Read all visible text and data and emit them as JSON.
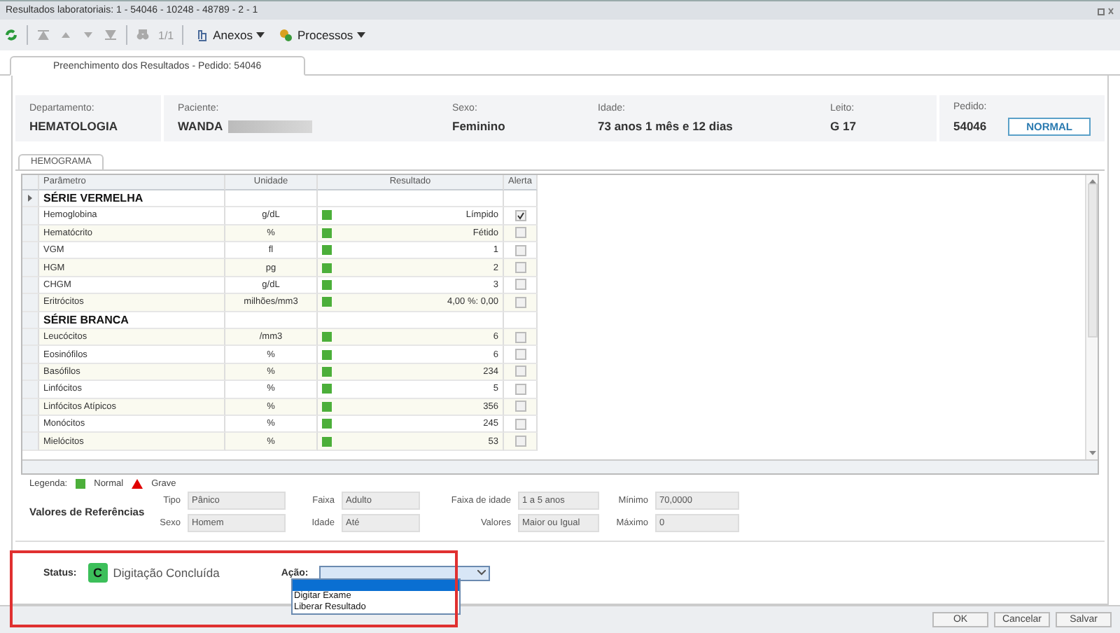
{
  "window": {
    "title": "Resultados laboratoriais: 1 - 54046 - 10248 - 48789 - 2 - 1"
  },
  "toolbar": {
    "pager": "1/1",
    "menus": [
      {
        "label": "Anexos",
        "kind": "attach"
      },
      {
        "label": "Processos",
        "kind": "process"
      }
    ]
  },
  "tabs": [
    {
      "label": "Preenchimento dos Resultados - Pedido: 54046",
      "selected": true
    }
  ],
  "header_fields": [
    {
      "label": "Departamento:",
      "value": "HEMATOLOGIA"
    },
    {
      "label": "Paciente:",
      "value": "WANDA",
      "redacted": true
    },
    {
      "label": "Sexo:",
      "value": "Feminino"
    },
    {
      "label": "Idade:",
      "value": "73 anos 1 mês  e 12 dias"
    },
    {
      "label": "Leito:",
      "value": "G 17"
    }
  ],
  "pedido": {
    "label": "Pedido:",
    "value": "54046",
    "priority": "NORMAL"
  },
  "subtabs": [
    {
      "label": "HEMOGRAMA",
      "selected": true
    }
  ],
  "table": {
    "columns": [
      "Parâmetro",
      "Unidade",
      "Resultado",
      "Alerta"
    ],
    "rows": [
      {
        "kind": "group",
        "name": "SÉRIE VERMELHA",
        "current": true
      },
      {
        "kind": "param",
        "name": "Hemoglobina",
        "unit": "g/dL",
        "result": "Límpido",
        "color": "#4caf3a",
        "alert": true
      },
      {
        "kind": "param",
        "name": "Hematócrito",
        "unit": "%",
        "result": "Fétido",
        "color": "#4caf3a",
        "alert": false
      },
      {
        "kind": "param",
        "name": "VGM",
        "unit": "fl",
        "result": "1",
        "color": "#4caf3a",
        "alert": false
      },
      {
        "kind": "param",
        "name": "HGM",
        "unit": "pg",
        "result": "2",
        "color": "#4caf3a",
        "alert": false
      },
      {
        "kind": "param",
        "name": "CHGM",
        "unit": "g/dL",
        "result": "3",
        "color": "#4caf3a",
        "alert": false
      },
      {
        "kind": "param",
        "name": "Eritrócitos",
        "unit": "milhões/mm3",
        "result": "4,00 %: 0,00",
        "color": "#4caf3a",
        "alert": false
      },
      {
        "kind": "group",
        "name": "SÉRIE BRANCA",
        "current": false
      },
      {
        "kind": "param",
        "name": "Leucócitos",
        "unit": "/mm3",
        "result": "6",
        "color": "#4caf3a",
        "alert": false
      },
      {
        "kind": "param",
        "name": "Eosinófilos",
        "unit": "%",
        "result": "6",
        "color": "#4caf3a",
        "alert": false
      },
      {
        "kind": "param",
        "name": "Basófilos",
        "unit": "%",
        "result": "234",
        "color": "#4caf3a",
        "alert": false
      },
      {
        "kind": "param",
        "name": "Linfócitos",
        "unit": "%",
        "result": "5",
        "color": "#4caf3a",
        "alert": false
      },
      {
        "kind": "param",
        "name": "Linfócitos Atípicos",
        "unit": "%",
        "result": "356",
        "color": "#4caf3a",
        "alert": false
      },
      {
        "kind": "param",
        "name": "Monócitos",
        "unit": "%",
        "result": "245",
        "color": "#4caf3a",
        "alert": false
      },
      {
        "kind": "param",
        "name": "Mielócitos",
        "unit": "%",
        "result": "53",
        "color": "#4caf3a",
        "alert": false
      }
    ]
  },
  "legend": {
    "label": "Legenda:",
    "items": [
      {
        "kind": "square",
        "label": "Normal",
        "color": "#4caf3a"
      },
      {
        "kind": "triangle",
        "label": "Grave",
        "color": "#e00000"
      }
    ]
  },
  "references": {
    "title": "Valores de Referências",
    "fields": [
      {
        "label": "Tipo",
        "value": "Pânico"
      },
      {
        "label": "Faixa",
        "value": "Adulto"
      },
      {
        "label": "Faixa de idade",
        "value": "1 a 5 anos"
      },
      {
        "label": "Mínimo",
        "value": "70,0000"
      },
      {
        "label": "Sexo",
        "value": "Homem"
      },
      {
        "label": "Idade",
        "value": "Até"
      },
      {
        "label": "Valores",
        "value": "Maior ou Igual"
      },
      {
        "label": "Máximo",
        "value": "0"
      }
    ]
  },
  "status": {
    "label": "Status:",
    "code": "C",
    "text": "Digitação Concluída"
  },
  "action": {
    "label": "Ação:",
    "open": true,
    "options": [
      {
        "selected": true
      },
      {
        "label": "Digitar Exame",
        "selected": false
      },
      {
        "label": "Liberar Resultado",
        "selected": false
      }
    ]
  },
  "buttons": [
    "OK",
    "Cancelar",
    "Salvar"
  ]
}
